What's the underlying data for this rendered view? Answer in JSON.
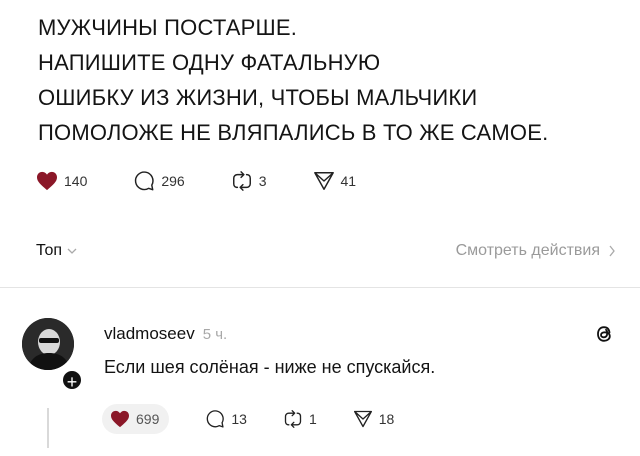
{
  "post": {
    "lines": [
      "МУЖЧИНЫ ПОСТАРШЕ.",
      "НАПИШИТЕ ОДНУ ФАТАЛЬНУЮ",
      "ОШИБКУ ИЗ ЖИЗНИ, ЧТОБЫ МАЛЬЧИКИ",
      "ПОМОЛОЖЕ НЕ ВЛЯПАЛИСЬ В ТО ЖЕ САМОЕ."
    ],
    "likes": "140",
    "replies": "296",
    "reposts": "3",
    "shares": "41"
  },
  "filter": {
    "sort_label": "Топ",
    "view_actions_label": "Смотреть действия"
  },
  "comment": {
    "username": "vladmoseev",
    "time": "5 ч.",
    "text": "Если шея солёная - ниже не спускайся.",
    "likes": "699",
    "replies": "13",
    "reposts": "1",
    "shares": "18"
  },
  "colors": {
    "heart": "#8b1728",
    "muted": "#9a9a9a"
  },
  "icons": [
    "heart-icon",
    "reply-icon",
    "repost-icon",
    "share-icon",
    "chevron-down-icon",
    "chevron-right-icon",
    "threads-logo-icon",
    "plus-icon"
  ]
}
